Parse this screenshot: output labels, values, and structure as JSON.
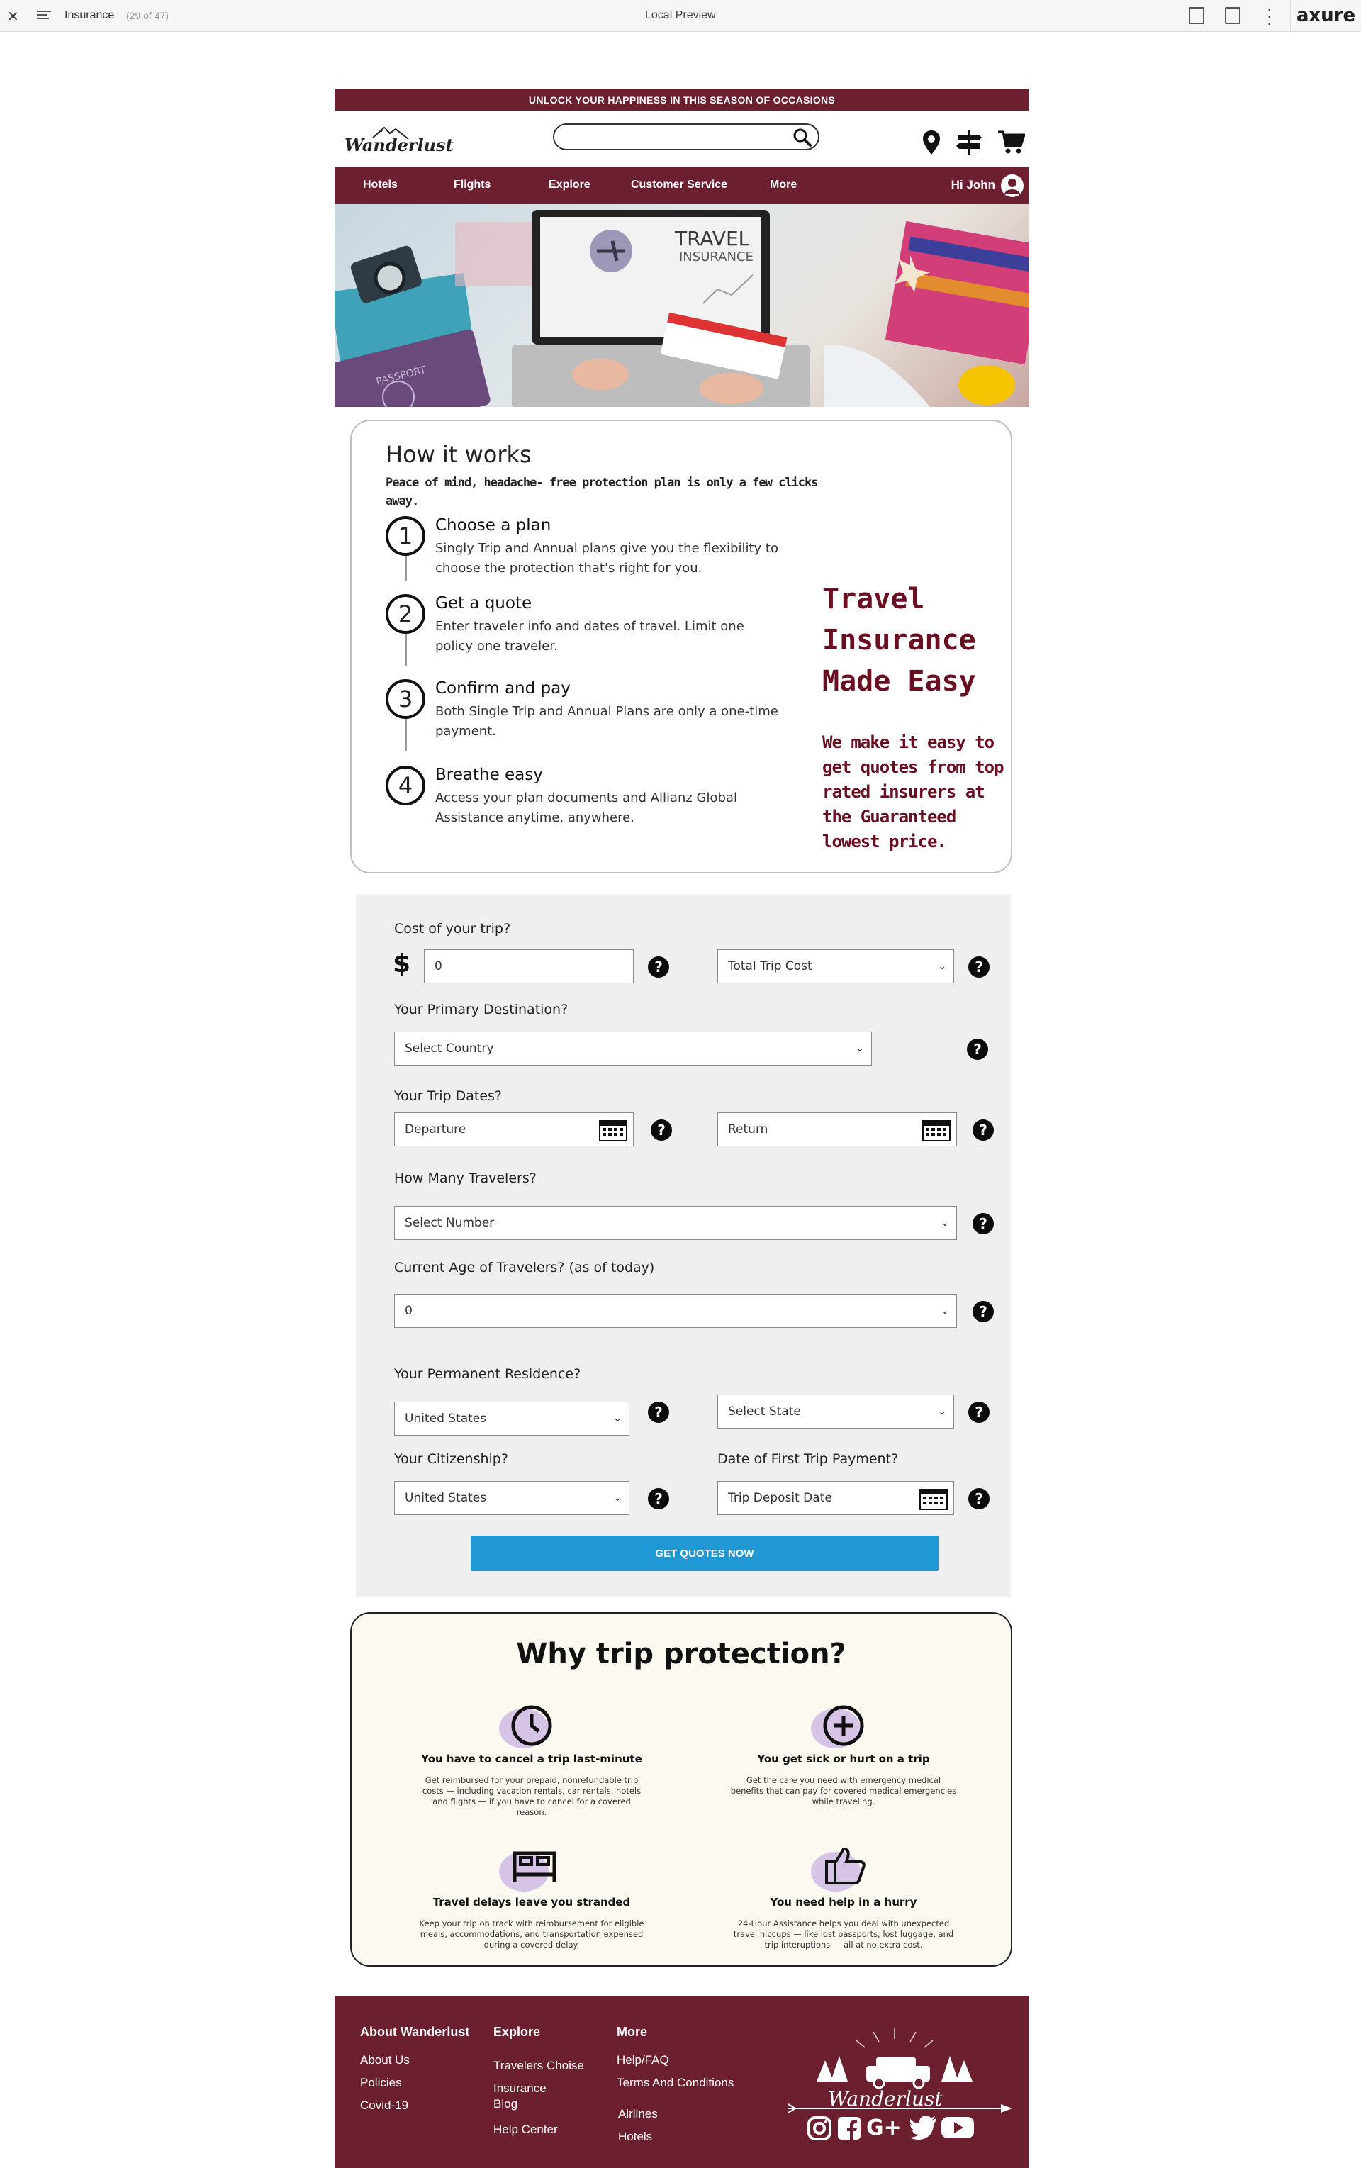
{
  "preview": {
    "page_name": "Insurance",
    "page_count": "(29 of 47)",
    "title": "Local Preview",
    "brand": "axure"
  },
  "promo": "UNLOCK YOUR HAPPINESS IN THIS SEASON OF OCCASIONS",
  "brand_name": "Wanderlust",
  "search": {
    "placeholder": ""
  },
  "nav": {
    "items": [
      "Hotels",
      "Flights",
      "Explore",
      "Customer Service",
      "More"
    ],
    "greeting": "Hi John"
  },
  "hero": {
    "heading": "TRAVEL",
    "subheading": "INSURANCE",
    "passport_text": "PASSPORT"
  },
  "how": {
    "title": "How it works",
    "subtitle": "Peace of mind, headache- free protection plan is only a few clicks away.",
    "steps": [
      {
        "num": "1",
        "title": "Choose a plan",
        "desc": "Singly Trip and Annual plans give you the flexibility to choose the protection that's right for you."
      },
      {
        "num": "2",
        "title": "Get a quote",
        "desc": "Enter traveler info and dates of travel. Limit one policy one traveler."
      },
      {
        "num": "3",
        "title": "Confirm and pay",
        "desc": "Both Single Trip and Annual Plans are only a one-time payment."
      },
      {
        "num": "4",
        "title": "Breathe easy",
        "desc": "Access your plan documents and Allianz Global Assistance anytime, anywhere."
      }
    ],
    "tagline_title": "Travel Insurance Made Easy",
    "tagline_body": "We make it easy to get quotes from top rated insurers at the Guaranteed lowest price."
  },
  "form": {
    "cost_label": "Cost of your trip?",
    "currency_symbol": "$",
    "cost_value": "0",
    "cost_type": "Total Trip Cost",
    "destination_label": "Your Primary Destination?",
    "destination_value": "Select Country",
    "dates_label": "Your Trip Dates?",
    "departure": "Departure",
    "return": "Return",
    "travelers_label": "How Many Travelers?",
    "travelers_value": "Select Number",
    "age_label": "Current Age of Travelers? (as of today)",
    "age_value": "0",
    "residence_label": "Your Permanent Residence?",
    "residence_value": "United States",
    "state_value": "Select State",
    "citizenship_label": "Your Citizenship?",
    "citizenship_value": "United States",
    "payment_label": "Date of First Trip Payment?",
    "payment_value": "Trip Deposit Date",
    "help_glyph": "?",
    "submit": "GET QUOTES NOW"
  },
  "why": {
    "title": "Why trip protection?",
    "features": [
      {
        "icon": "clock-icon",
        "title": "You have to cancel a trip last-minute",
        "desc": "Get reimbursed for your prepaid, nonrefundable trip costs — including vacation rentals, car rentals, hotels and flights — if you have to cancel for a covered reason."
      },
      {
        "icon": "medical-plus-icon",
        "title": "You get sick or hurt on a trip",
        "desc": "Get the care you need with emergency medical benefits that can pay for covered medical emergencies while traveling."
      },
      {
        "icon": "bed-icon",
        "title": "Travel delays leave you stranded",
        "desc": "Keep your trip on track with reimbursement for eligible meals, accommodations, and transportation expensed during a covered delay."
      },
      {
        "icon": "thumbs-up-icon",
        "title": "You need help in a hurry",
        "desc": "24-Hour Assistance helps you deal with unexpected travel hiccups — like lost passports, lost luggage, and trip interuptions — all at no extra cost."
      }
    ]
  },
  "footer": {
    "col1_title": "About Wanderlust",
    "col1": [
      "About Us",
      "Policies",
      "Covid-19"
    ],
    "col2_title": "Explore",
    "col2": [
      "Travelers Choise",
      "Insurance",
      "Blog",
      "Help Center"
    ],
    "col3_title": "More",
    "col3": [
      "Help/FAQ",
      "Terms And Conditions",
      "Airlines",
      "Hotels"
    ],
    "brand": "Wanderlust",
    "social": [
      "instagram-icon",
      "facebook-icon",
      "google-plus-icon",
      "twitter-icon",
      "youtube-icon"
    ],
    "gplus_text": "G+"
  },
  "colors": {
    "brand": "#6c1f2e",
    "accent": "#1f98d4",
    "tagline": "#6a0f22"
  }
}
